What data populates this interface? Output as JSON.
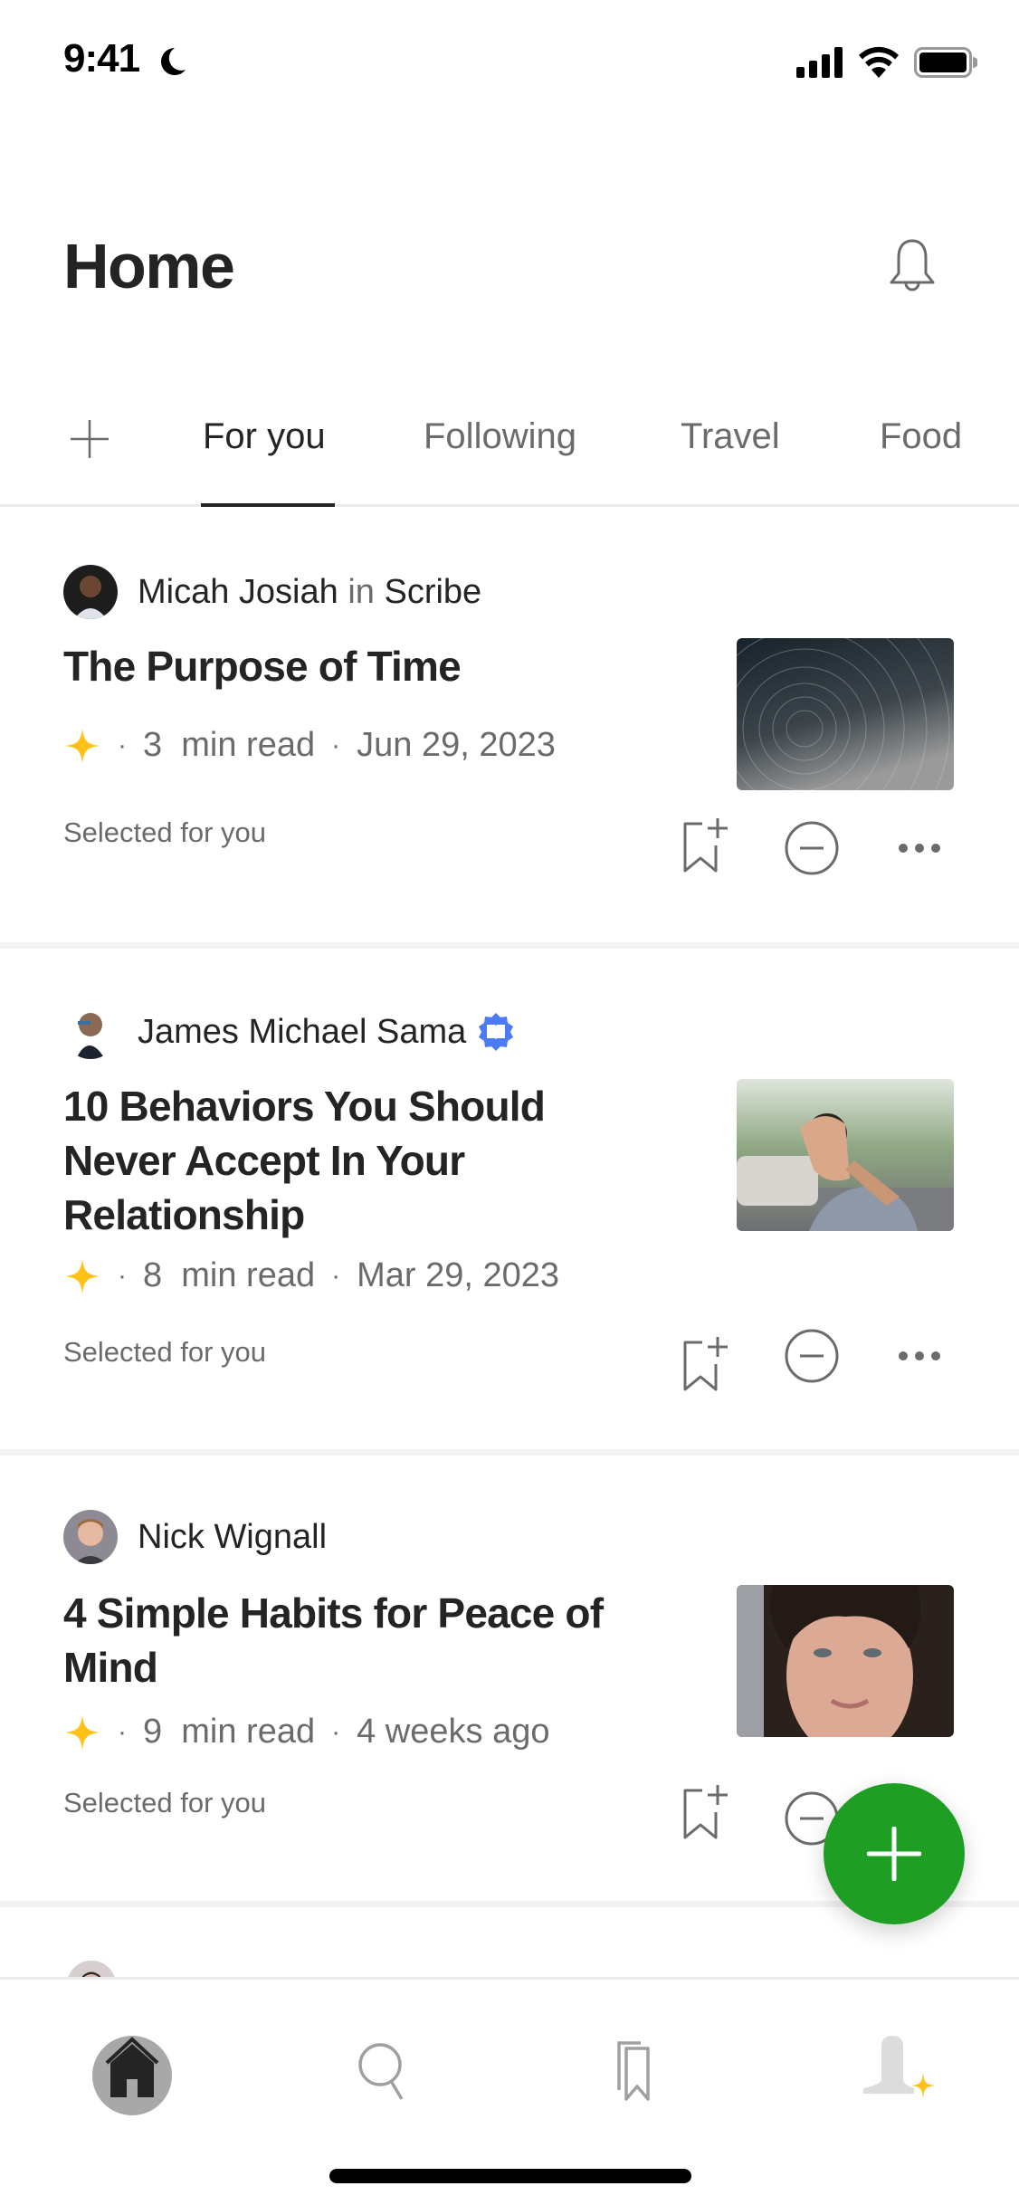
{
  "status_bar": {
    "time": "9:41",
    "icons": [
      "moon-icon",
      "signal-icon",
      "wifi-icon",
      "battery-icon"
    ]
  },
  "header": {
    "title": "Home",
    "notification_icon": "bell-icon"
  },
  "tabs": {
    "add_icon": "plus-icon",
    "items": [
      {
        "label": "For you",
        "active": true
      },
      {
        "label": "Following",
        "active": false
      },
      {
        "label": "Travel",
        "active": false
      },
      {
        "label": "Food",
        "active": false
      }
    ]
  },
  "articles": [
    {
      "author": "Micah Josiah",
      "in_word": "in",
      "publication": "Scribe",
      "verified": false,
      "title": "The Purpose of Time",
      "member_only": true,
      "read_time": "3",
      "read_label": "min read",
      "date": "Jun 29, 2023",
      "reason": "Selected for you",
      "thumbnail": "star-trails-night-sky"
    },
    {
      "author": "James Michael Sama",
      "verified": true,
      "title": "10 Behaviors You Should Never Accept In Your Relationship",
      "member_only": true,
      "read_time": "8",
      "read_label": "min read",
      "date": "Mar 29, 2023",
      "reason": "Selected for you",
      "thumbnail": "person-hand-blocking-face"
    },
    {
      "author": "Nick Wignall",
      "verified": false,
      "title": "4 Simple Habits for Peace of Mind",
      "member_only": true,
      "read_time": "9",
      "read_label": "min read",
      "date": "4 weeks ago",
      "reason": "Selected for you",
      "thumbnail": "woman-portrait"
    }
  ],
  "card_actions": [
    "bookmark-add-icon",
    "hide-circle-minus-icon",
    "more-dots-icon"
  ],
  "fab": {
    "icon": "plus-icon"
  },
  "bottom_nav": [
    {
      "name": "home",
      "icon": "home-icon",
      "active": true
    },
    {
      "name": "search",
      "icon": "search-icon",
      "active": false
    },
    {
      "name": "library",
      "icon": "bookmarks-icon",
      "active": false
    },
    {
      "name": "profile",
      "icon": "profile-icon",
      "active": false
    }
  ],
  "colors": {
    "text_primary": "#242424",
    "text_secondary": "#6b6b6b",
    "member_star": "#ffc017",
    "verified_badge": "#4b7bf5",
    "fab_green": "#1f9e24",
    "divider": "#f2f2f2"
  }
}
